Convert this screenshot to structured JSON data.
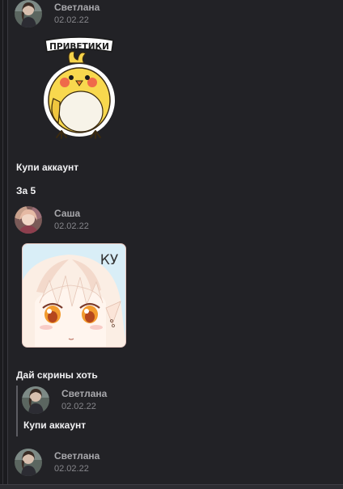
{
  "messages": [
    {
      "author": "Светлана",
      "date": "02.02.22",
      "sticker": {
        "label": "ПРИВЕТИКИ",
        "icon": "chick-sticker"
      }
    },
    {
      "text": "Купи аккаунт"
    },
    {
      "text": "За 5"
    },
    {
      "author": "Саша",
      "date": "02.02.22",
      "sticker": {
        "label": "КУ",
        "icon": "anime-girl-sticker"
      }
    },
    {
      "text": "Дай скрины хоть",
      "reply": {
        "author": "Светлана",
        "date": "02.02.22",
        "text": "Купи аккаунт"
      }
    },
    {
      "author": "Светлана",
      "date": "02.02.22"
    }
  ],
  "colors": {
    "background": "#222226",
    "text": "#f2f2f4",
    "author": "#a8a8ac",
    "date": "#86868b"
  }
}
